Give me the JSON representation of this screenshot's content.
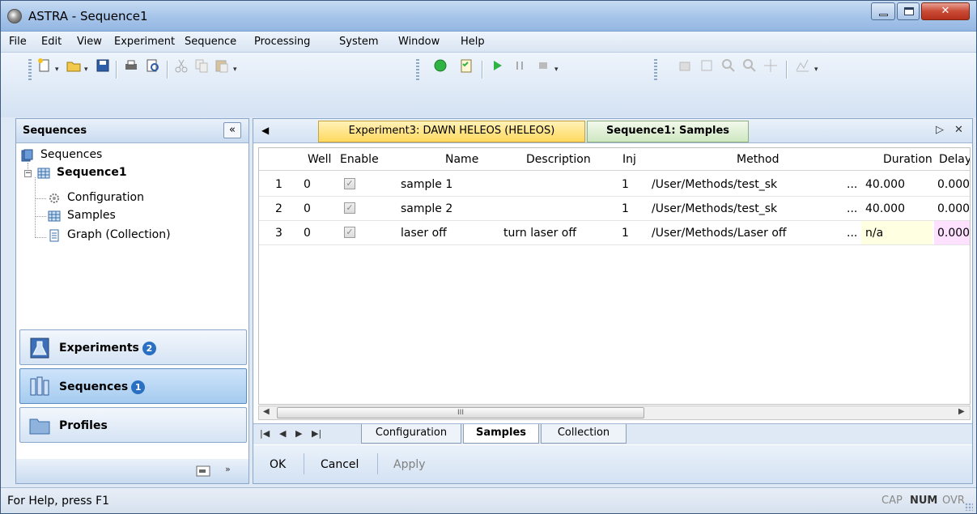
{
  "window": {
    "title": "ASTRA - Sequence1"
  },
  "menu": [
    "File",
    "Edit",
    "View",
    "Experiment",
    "Sequence",
    "Processing",
    "System",
    "Window",
    "Help"
  ],
  "left_pane": {
    "header": "Sequences",
    "collapse_label": "«",
    "tree": {
      "root": "Sequences",
      "sequence": "Sequence1",
      "children": [
        "Configuration",
        "Samples",
        "Graph (Collection)"
      ]
    },
    "nav": [
      {
        "label": "Experiments",
        "badge": "2"
      },
      {
        "label": "Sequences",
        "badge": "1"
      },
      {
        "label": "Profiles",
        "badge": ""
      }
    ]
  },
  "tabs": {
    "experiment": "Experiment3: DAWN HELEOS (HELEOS)",
    "sequence": "Sequence1: Samples"
  },
  "grid": {
    "columns": [
      "Well",
      "Enable",
      "Name",
      "Description",
      "Inj",
      "Method",
      "Duration",
      "Delay"
    ],
    "rows": [
      {
        "num": "1",
        "well": "0",
        "enable": "✓",
        "name": "sample 1",
        "description": "",
        "inj": "1",
        "method": "/User/Methods/test_sk",
        "ellipsis": "...",
        "duration": "40.000",
        "delay": "0.000"
      },
      {
        "num": "2",
        "well": "0",
        "enable": "✓",
        "name": "sample 2",
        "description": "",
        "inj": "1",
        "method": "/User/Methods/test_sk",
        "ellipsis": "...",
        "duration": "40.000",
        "delay": "0.000"
      },
      {
        "num": "3",
        "well": "0",
        "enable": "✓",
        "name": "laser off",
        "description": "turn laser off",
        "inj": "1",
        "method": "/User/Methods/Laser off",
        "ellipsis": "...",
        "duration": "n/a",
        "delay": "0.000"
      }
    ],
    "scroll_thumb": "III"
  },
  "sheet_tabs": [
    "Configuration",
    "Samples",
    "Collection"
  ],
  "actions": {
    "ok": "OK",
    "cancel": "Cancel",
    "apply": "Apply"
  },
  "status": {
    "text": "For Help, press F1",
    "cap": "CAP",
    "num": "NUM",
    "ovr": "OVR"
  }
}
